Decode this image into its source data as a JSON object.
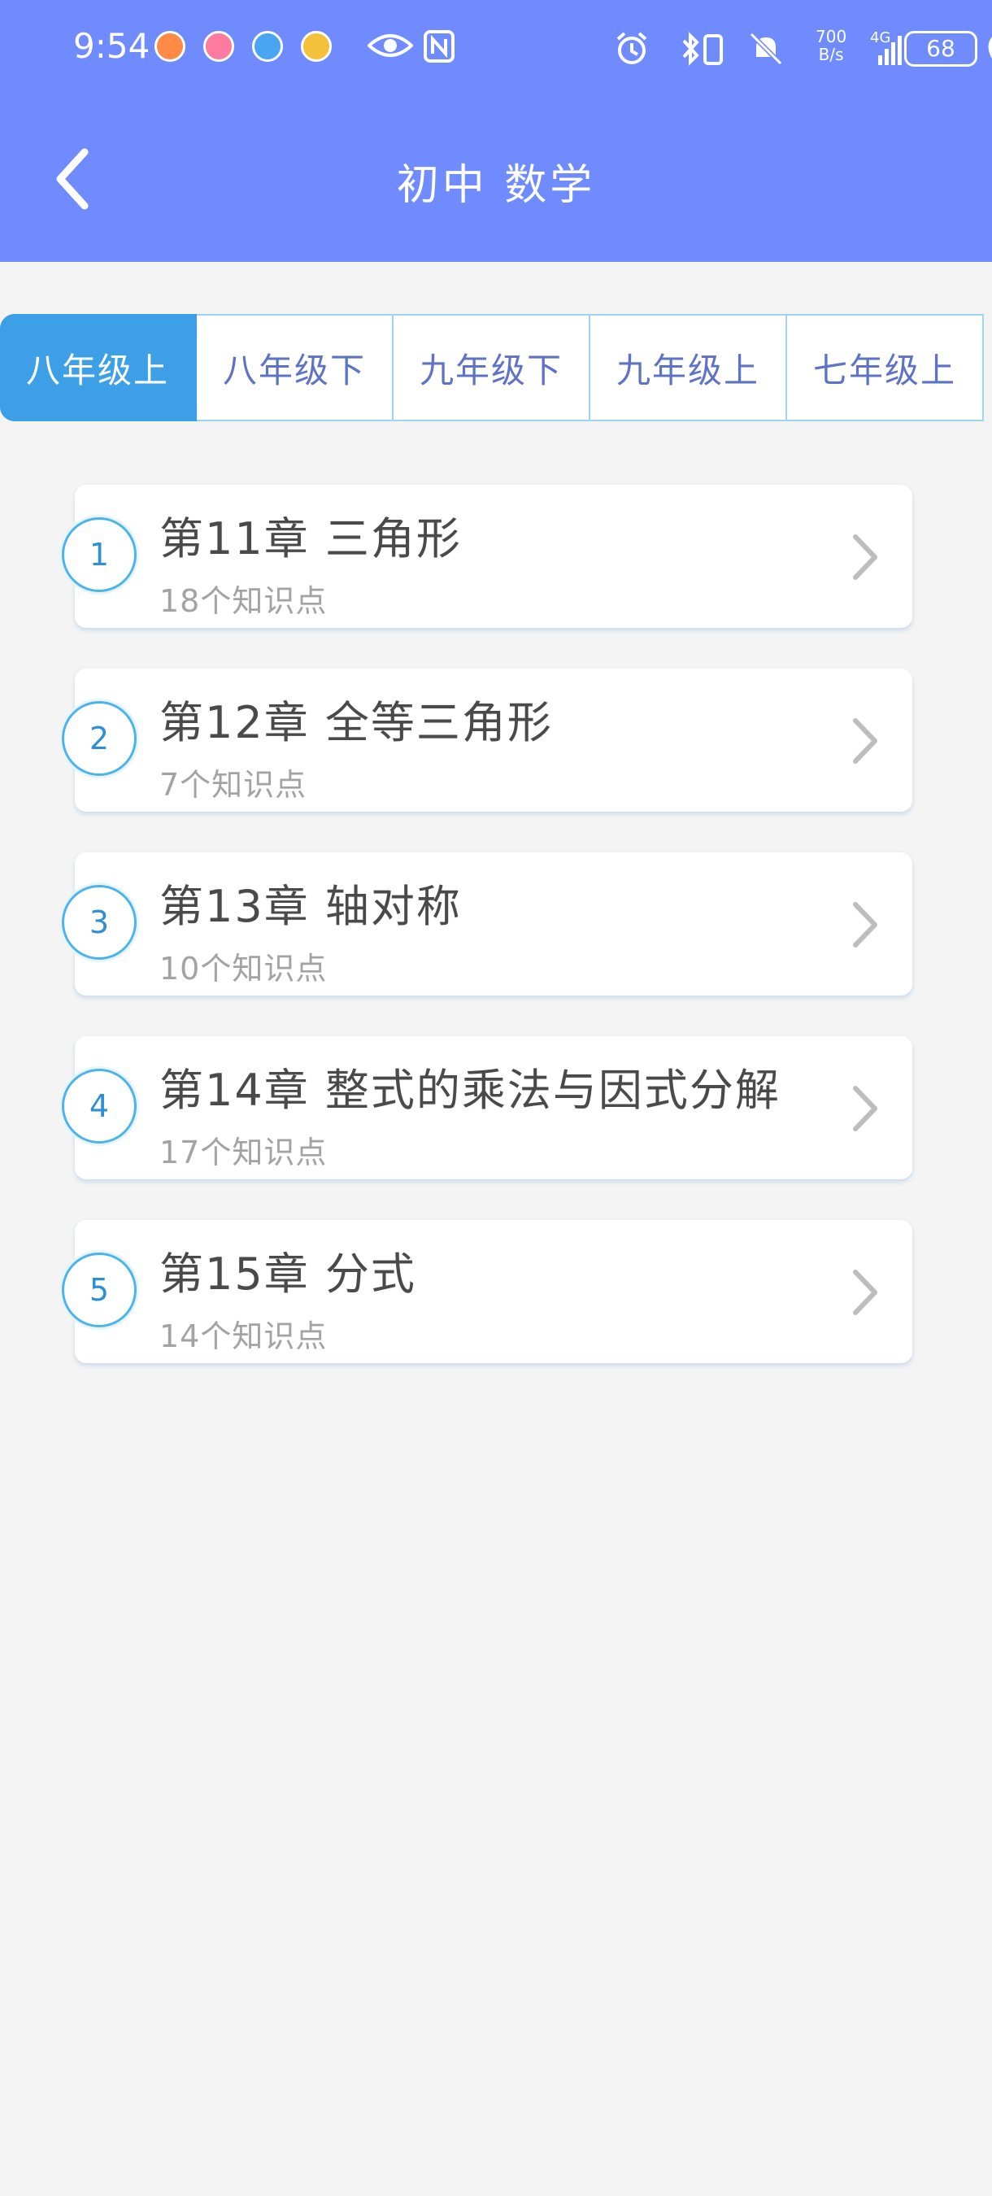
{
  "status_bar": {
    "time": "9:54",
    "network_speed_value": "700",
    "network_speed_unit": "B/s",
    "network_type": "4G",
    "battery_level": "68",
    "icons": [
      "notification-app-icon",
      "notification-app-icon",
      "notification-app-icon",
      "play-icon",
      "eye-icon",
      "nfc-icon",
      "alarm-icon",
      "bluetooth-icon",
      "mute-bell-icon",
      "signal-icon",
      "battery-icon",
      "leaf-icon"
    ]
  },
  "header": {
    "title": "初中 数学",
    "back_icon": "chevron-left-icon"
  },
  "tabs": [
    {
      "label": "八年级上",
      "active": true
    },
    {
      "label": "八年级下",
      "active": false
    },
    {
      "label": "九年级下",
      "active": false
    },
    {
      "label": "九年级上",
      "active": false
    },
    {
      "label": "七年级上",
      "active": false
    }
  ],
  "chapters": [
    {
      "index": "1",
      "title": "第11章 三角形",
      "count": "18个知识点"
    },
    {
      "index": "2",
      "title": "第12章 全等三角形",
      "count": "7个知识点"
    },
    {
      "index": "3",
      "title": "第13章 轴对称",
      "count": "10个知识点"
    },
    {
      "index": "4",
      "title": "第14章 整式的乘法与因式分解",
      "count": "17个知识点"
    },
    {
      "index": "5",
      "title": "第15章 分式",
      "count": "14个知识点"
    }
  ],
  "colors": {
    "header_bg": "#6f8bfd",
    "tab_active_bg": "#3d9fe5",
    "tab_text": "#5f73c6",
    "circle_border": "#4bb4ea",
    "page_bg": "#f4f4f4"
  }
}
